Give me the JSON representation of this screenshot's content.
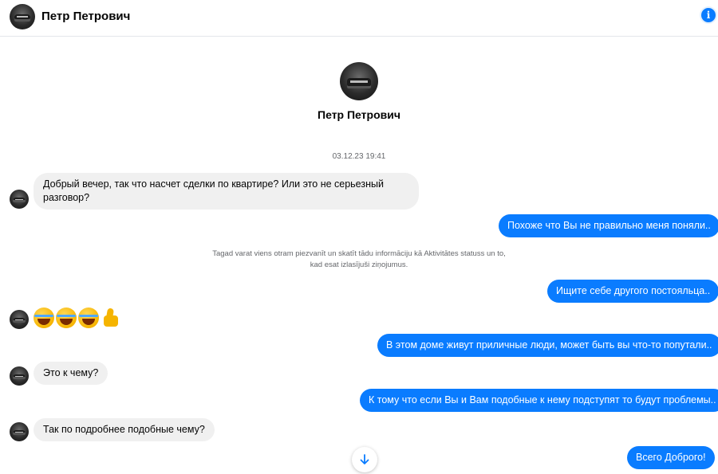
{
  "header": {
    "contact_name": "Петр Петрович",
    "info_icon": "info-icon"
  },
  "profile": {
    "name": "Петр Петрович"
  },
  "conversation": {
    "timestamp": "03.12.23 19:41",
    "notice": "Tagad varat viens otram piezvanīt un skatīt tādu informāciju kā Aktivitātes statuss un to, kad esat izlasījuši ziņojumus.",
    "messages": [
      {
        "from": "them",
        "text": "Добрый вечер, так что насчет сделки по квартире? Или это не серьезный разговор?"
      },
      {
        "from": "me",
        "text": "Похоже что Вы не правильно меня поняли.."
      },
      {
        "from": "me",
        "text": "Ищите себе другого постояльца.."
      },
      {
        "from": "them",
        "emoji": [
          "rolling-laughing-emoji",
          "rolling-laughing-emoji",
          "rolling-laughing-emoji",
          "thumbs-up-emoji"
        ]
      },
      {
        "from": "me",
        "text": "В этом доме живут приличные люди, может быть вы что-то попутали.."
      },
      {
        "from": "them",
        "text": "Это к чему?"
      },
      {
        "from": "me",
        "text": "К тому что если Вы и Вам подобные к нему подступят то будут проблемы.."
      },
      {
        "from": "them",
        "text": "Так по подробнее подобные чему?"
      },
      {
        "from": "me",
        "text": "Всего Доброго!"
      }
    ]
  },
  "controls": {
    "scroll_down_icon": "arrow-down-icon"
  },
  "colors": {
    "outgoing_bubble": "#0a7cff",
    "incoming_bubble": "#f0f0f0",
    "meta_text": "#65676b"
  }
}
